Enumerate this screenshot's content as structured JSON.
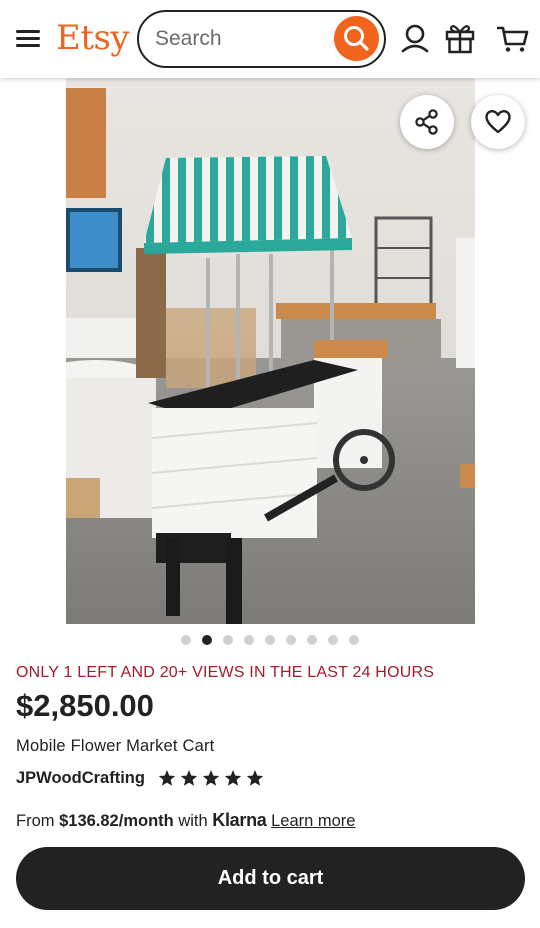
{
  "header": {
    "logo": "Etsy",
    "search_placeholder": "Search",
    "icons": [
      "menu-icon",
      "search-icon",
      "account-icon",
      "gift-icon",
      "cart-icon"
    ]
  },
  "listing": {
    "image_count": 9,
    "active_image": 2,
    "scarcity_text": "ONLY 1 LEFT AND 20+ VIEWS IN THE LAST 24 HOURS",
    "price": "$2,850.00",
    "title": "Mobile Flower Market Cart",
    "shop_name": "JPWoodCrafting",
    "rating": 5,
    "rating_max": 5
  },
  "financing": {
    "from": "From",
    "amount": "$136.82/month",
    "with": "with",
    "provider": "Klarna",
    "link": "Learn more"
  },
  "actions": {
    "add_to_cart": "Add to cart"
  },
  "colors": {
    "brand": "#f1641e",
    "scarcity": "#a61a2e",
    "button": "#222222",
    "canopy_stripe": "#2aa89a"
  }
}
